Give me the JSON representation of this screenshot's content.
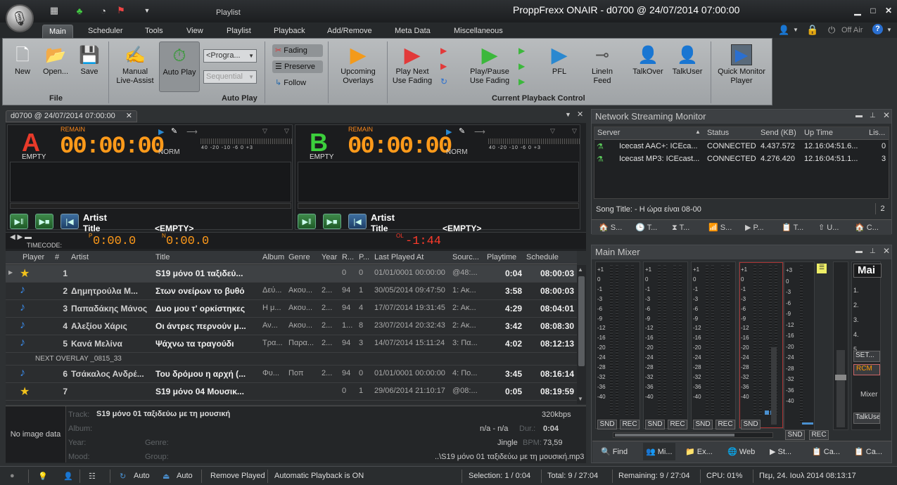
{
  "app": {
    "title": "ProppFrexx ONAIR - d0700 @ 24/07/2014 07:00:00",
    "context_tab": "Playlist"
  },
  "menu": {
    "tabs": [
      "Main",
      "Scheduler",
      "Tools",
      "View",
      "Playlist",
      "Playback",
      "Add/Remove",
      "Meta Data",
      "Miscellaneous"
    ],
    "off_air": "Off Air"
  },
  "ribbon": {
    "file": {
      "group": "File",
      "new": "New",
      "open": "Open...",
      "save": "Save"
    },
    "autoplay": {
      "group": "Auto Play",
      "manual_1": "Manual",
      "manual_2": "Live-Assist",
      "auto_play": "Auto Play",
      "program_combo": "<Progra...",
      "sequential_combo": "Sequential"
    },
    "fading": {
      "fading": "Fading",
      "preserve": "Preserve",
      "follow": "Follow"
    },
    "upcoming": {
      "line1": "Upcoming",
      "line2": "Overlays"
    },
    "playback": {
      "group": "Current Playback Control",
      "play_next_1": "Play Next",
      "play_next_2": "Use Fading",
      "play_pause_1": "Play/Pause",
      "play_pause_2": "Use Fading",
      "pfl": "PFL",
      "linein_1": "LineIn",
      "linein_2": "Feed",
      "talkover": "TalkOver",
      "talkuser": "TalkUser"
    },
    "monitor": {
      "line1": "Quick Monitor",
      "line2": "Player"
    }
  },
  "doc_tab": "d0700 @ 24/07/2014 07:00:00",
  "players": [
    {
      "letter": "A",
      "remain": "REMAIN",
      "time": "00:00:00",
      "status": "EMPTY",
      "norm": "NORM",
      "artist": "Artist",
      "title_label": "Title",
      "title_value": "<EMPTY>",
      "color": "#e83a2a"
    },
    {
      "letter": "B",
      "remain": "REMAIN",
      "time": "00:00:00",
      "status": "EMPTY",
      "norm": "NORM",
      "artist": "Artist",
      "title_label": "Title",
      "title_value": "<EMPTY>",
      "color": "#3ccf3c"
    }
  ],
  "vu_scale": "40 -20  -10  -6    0  +3",
  "timecode": {
    "label": "TIMECODE:",
    "p": "0:00.0",
    "n": "0:00.0",
    "ol": "-1:44"
  },
  "playlist": {
    "columns": [
      "Player",
      "#",
      "Artist",
      "Title",
      "Album",
      "Genre",
      "Year",
      "R...",
      "P...",
      "Last Played At",
      "Sourc...",
      "Playtime",
      "Schedule"
    ],
    "rows": [
      {
        "icon": "star",
        "num": "1",
        "artist": "",
        "title": "S19 μόνο 01 ταξιδεύ...",
        "album": "",
        "genre": "",
        "year": "",
        "r": "0",
        "p": "0",
        "last": "01/01/0001 00:00:00",
        "src": "@48:...",
        "play": "0:04",
        "sched": "08:00:03",
        "sel": true
      },
      {
        "icon": "note",
        "num": "2",
        "artist": "Δημητρούλα Μ...",
        "title": "Στων ονείρων το βυθό",
        "album": "Δεύ...",
        "genre": "Ακου...",
        "year": "2...",
        "r": "94",
        "p": "1",
        "last": "30/05/2014 09:47:50",
        "src": "1: Ακ...",
        "play": "3:58",
        "sched": "08:00:03"
      },
      {
        "icon": "note",
        "num": "3",
        "artist": "Παπαδάκης Μάνος",
        "title": "Δυο μου τ' ορκίστηκες",
        "album": "Η μ...",
        "genre": "Ακου...",
        "year": "2...",
        "r": "94",
        "p": "4",
        "last": "17/07/2014 19:31:45",
        "src": "2: Ακ...",
        "play": "4:29",
        "sched": "08:04:01"
      },
      {
        "icon": "note",
        "num": "4",
        "artist": "Αλεξίου Χάρις",
        "title": "Οι άντρες περνούν μ...",
        "album": "Αν...",
        "genre": "Ακου...",
        "year": "2...",
        "r": "1...",
        "p": "8",
        "last": "23/07/2014 20:32:43",
        "src": "2: Ακ...",
        "play": "3:42",
        "sched": "08:08:30"
      },
      {
        "icon": "note",
        "num": "5",
        "artist": "Κανά Μελίνα",
        "title": "Ψάχνω τα τραγούδι",
        "album": "Τρα...",
        "genre": "Παρα...",
        "year": "2...",
        "r": "94",
        "p": "3",
        "last": "14/07/2014 15:11:24",
        "src": "3: Πα...",
        "play": "4:02",
        "sched": "08:12:13"
      },
      {
        "icon": "note",
        "num": "6",
        "artist": "Τσάκαλος Ανδρέ...",
        "title": "Του δρόμου η αρχή (...",
        "album": "Φυ...",
        "genre": "Ποπ",
        "year": "2...",
        "r": "94",
        "p": "0",
        "last": "01/01/0001 00:00:00",
        "src": "4: Πο...",
        "play": "3:45",
        "sched": "08:16:14"
      },
      {
        "icon": "star",
        "num": "7",
        "artist": "",
        "title": "S19 μόνο 04 Μουσικ...",
        "album": "",
        "genre": "",
        "year": "",
        "r": "0",
        "p": "1",
        "last": "29/06/2014 21:10:17",
        "src": "@08:...",
        "play": "0:05",
        "sched": "08:19:59"
      }
    ],
    "overlay_row": "NEXT OVERLAY _0815_33"
  },
  "info": {
    "no_image": "No image data",
    "track_label": "Track:",
    "track": "S19 μόνο 01 ταξιδεύω με τη μουσική",
    "bitrate": "320kbps",
    "album_label": "Album:",
    "nana": "n/a - n/a",
    "dur_label": "Dur.:",
    "dur": "0:04",
    "year_label": "Year:",
    "genre_label": "Genre:",
    "jingle": "Jingle",
    "bpm_label": "BPM:",
    "bpm": "73,59",
    "mood_label": "Mood:",
    "group_label": "Group:",
    "path": "..\\S19 μόνο 01 ταξιδεύω με τη μουσική.mp3"
  },
  "streaming": {
    "title": "Network Streaming Monitor",
    "columns": [
      "Server",
      "Status",
      "Send (KB)",
      "Up Time",
      "Lis..."
    ],
    "rows": [
      {
        "server": "Icecast AAC+: ICEca...",
        "status": "CONNECTED",
        "send": "4.437.572",
        "up": "12.16:04:51.6...",
        "lis": "0"
      },
      {
        "server": "Icecast MP3: ICEcast...",
        "status": "CONNECTED",
        "send": "4.276.420",
        "up": "12.16:04:51.1...",
        "lis": "3"
      }
    ],
    "song_title": "Song Title:  - Η ώρα είναι 08-00",
    "song_count": "2",
    "tabs": [
      "S...",
      "T...",
      "T...",
      "S...",
      "P...",
      "T...",
      "U...",
      "C..."
    ]
  },
  "mixer": {
    "title": "Main Mixer",
    "scale": [
      "+1",
      "0",
      "-1",
      "-3",
      "-6",
      "-9",
      "-12",
      "-16",
      "-20",
      "-24",
      "-28",
      "-32",
      "-36",
      "-40"
    ],
    "scale_b": [
      "+3",
      "0",
      "-3",
      "-6",
      "-9",
      "-12",
      "-16",
      "-20",
      "-24",
      "-28",
      "-32",
      "-36",
      "-40"
    ],
    "snd": "SND",
    "rec": "REC",
    "side": {
      "title": "Mai",
      "items": [
        "1.",
        "2.",
        "3.",
        "4.",
        "5."
      ],
      "set": "SET...",
      "rcm": "RCM",
      "mixer": "Mixer",
      "talkuser": "TalkUse"
    },
    "tabs": [
      "Find",
      "Mi...",
      "Ex...",
      "Web",
      "St...",
      "Ca...",
      "Ca..."
    ]
  },
  "statusbar": {
    "auto1": "Auto",
    "auto2": "Auto",
    "remove_played": "Remove Played",
    "auto_playback": "Automatic Playback is ON",
    "selection": "Selection: 1 / 0:04",
    "total": "Total: 9 / 27:04",
    "remaining": "Remaining: 9 / 27:04",
    "cpu": "CPU: 01%",
    "datetime": "Πεμ, 24. Ιουλ 2014 08:13:17"
  }
}
